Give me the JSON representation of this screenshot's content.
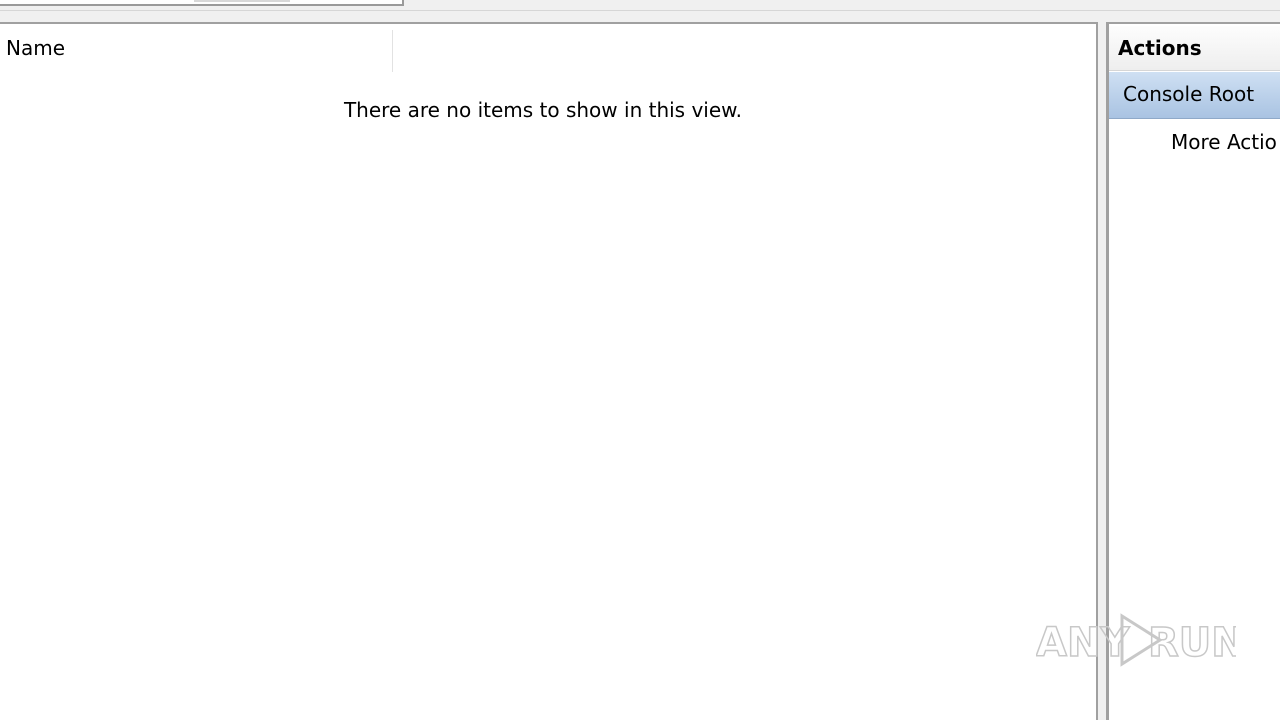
{
  "results": {
    "column_name": "Name",
    "empty_message": "There are no items to show in this view."
  },
  "actions": {
    "title": "Actions",
    "group": "Console Root",
    "item": "More Actio"
  },
  "watermark": {
    "left": "ANY",
    "right": "RUN"
  }
}
